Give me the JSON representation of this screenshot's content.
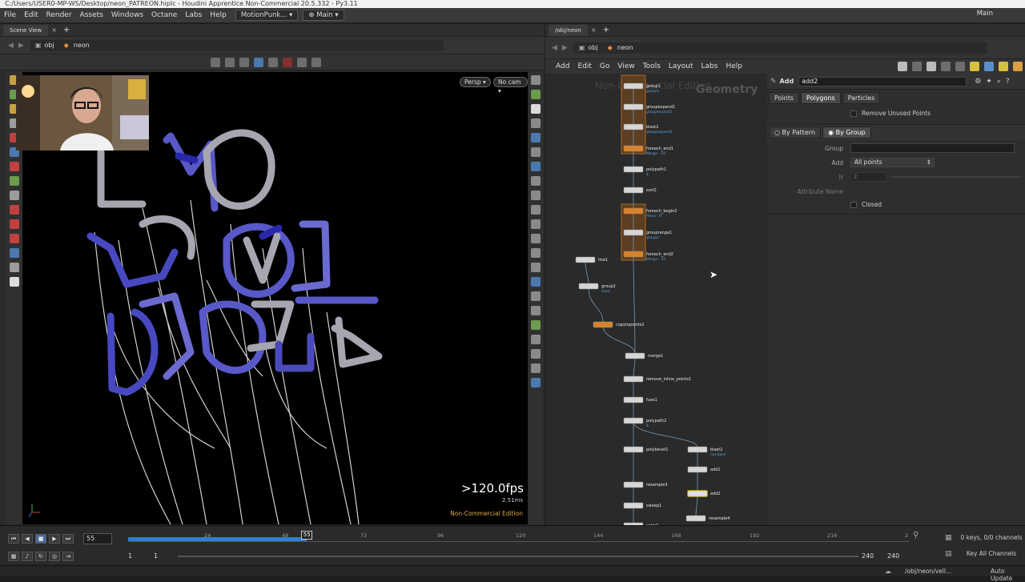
{
  "window": {
    "title": "C:/Users/USER0-MP-WS/Desktop/neon_PATREON.hiplc - Houdini Apprentice Non-Commercial 20.5.332 - Py3.11"
  },
  "menubar": {
    "items": [
      "File",
      "Edit",
      "Render",
      "Assets",
      "Windows",
      "Octane",
      "Labs",
      "Help"
    ],
    "desktop_select": "MotionPunk...",
    "context_select": "Main",
    "right_desktop": "Main"
  },
  "scene_view": {
    "tab_label": "Scene View",
    "path_obj": "obj",
    "path_node": "neon",
    "persp_label": "Persp",
    "cam_label": "No cam",
    "fps": ">120.0fps",
    "ms": "2.51ms",
    "edition": "Non-Commercial Edition"
  },
  "network": {
    "tab_label": "/obj/neon",
    "path_obj": "obj",
    "path_node": "neon",
    "menu": [
      "Add",
      "Edit",
      "Go",
      "View",
      "Tools",
      "Layout",
      "Labs",
      "Help"
    ],
    "watermark": "Non-Commercial Edition",
    "context_label": "Geometry",
    "nodes": [
      {
        "name": "group1",
        "sub": "group1"
      },
      {
        "name": "groupexpand1",
        "sub": "groupexpand1"
      },
      {
        "name": "blast1",
        "sub": "groupexpand1"
      },
      {
        "name": "foreach_end1",
        "sub": "Merge : 10"
      },
      {
        "name": "polypath1",
        "sub": "4"
      },
      {
        "name": "sort2",
        "sub": ""
      },
      {
        "name": "foreach_begin2",
        "sub": "Piece : 6"
      },
      {
        "name": "grouprange1",
        "sub": "group2"
      },
      {
        "name": "foreach_end2",
        "sub": "Merge : 10"
      },
      {
        "name": "line1",
        "sub": ""
      },
      {
        "name": "group2",
        "sub": "base"
      },
      {
        "name": "copytopoints1",
        "sub": ""
      },
      {
        "name": "merge1",
        "sub": ""
      },
      {
        "name": "remove_inline_points1",
        "sub": ""
      },
      {
        "name": "fuse1",
        "sub": ""
      },
      {
        "name": "polypath2",
        "sub": "4"
      },
      {
        "name": "polybevel1",
        "sub": ""
      },
      {
        "name": "blast2",
        "sub": "not base"
      },
      {
        "name": "add1",
        "sub": ""
      },
      {
        "name": "resample3",
        "sub": ""
      },
      {
        "name": "add2",
        "sub": ""
      },
      {
        "name": "sweep1",
        "sub": ""
      },
      {
        "name": "resample4",
        "sub": ""
      },
      {
        "name": "color1",
        "sub": ""
      }
    ]
  },
  "params": {
    "node_type": "Add",
    "node_name": "add2",
    "tabs": [
      "Points",
      "Polygons",
      "Particles"
    ],
    "active_tab": "Polygons",
    "remove_unused_label": "Remove Unused Points",
    "mode_options": [
      "By Pattern",
      "By Group"
    ],
    "active_mode": "By Group",
    "group_label": "Group",
    "add_label": "Add",
    "add_value": "All points",
    "n_label": "N",
    "n_value": "2",
    "attr_label": "Attribute Name",
    "closed_label": "Closed"
  },
  "timeline": {
    "current_frame": "55",
    "frame_marker": "55",
    "ticks": [
      "24",
      "48",
      "72",
      "96",
      "120",
      "144",
      "168",
      "192",
      "216",
      "2"
    ],
    "range_start": "1",
    "range_start2": "1",
    "range_end": "240",
    "range_end2": "240",
    "keys_info": "0 keys, 0/0 channels",
    "key_all_label": "Key All Channels",
    "progress": 0.229
  },
  "statusbar": {
    "path": "/obj/neon/vell...",
    "auto_update": "Auto Update"
  },
  "colors": {
    "accent_orange": "#d9822b",
    "timeline_blue": "#2f7fd0",
    "tube_blue": "#5a5ad0",
    "tube_grey": "#9a9aa6"
  }
}
